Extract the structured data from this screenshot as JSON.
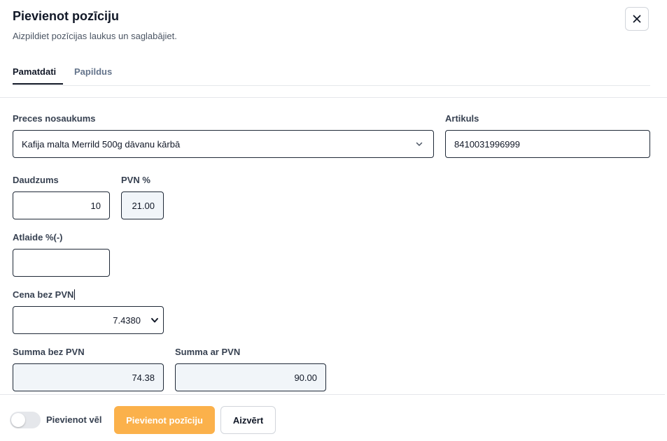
{
  "dialog": {
    "title": "Pievienot pozīciju",
    "subtitle": "Aizpildiet pozīcijas laukus un saglabājiet."
  },
  "tabs": [
    {
      "label": "Pamatdati",
      "active": true
    },
    {
      "label": "Papildus",
      "active": false
    }
  ],
  "form": {
    "product_name": {
      "label": "Preces nosaukums",
      "value": "Kafija malta Merrild 500g dāvanu kārbā"
    },
    "article": {
      "label": "Artikuls",
      "value": "8410031996999"
    },
    "quantity": {
      "label": "Daudzums",
      "value": "10"
    },
    "vat_percent": {
      "label": "PVN %",
      "value": "21.00"
    },
    "discount": {
      "label": "Atlaide %(-)",
      "value": ""
    },
    "price_excl_vat": {
      "label": "Cena bez PVN",
      "value": "7.4380"
    },
    "sum_excl_vat": {
      "label": "Summa bez PVN",
      "value": "74.38"
    },
    "sum_incl_vat": {
      "label": "Summa ar PVN",
      "value": "90.00"
    }
  },
  "footer": {
    "toggle_label": "Pievienot vēl",
    "toggle_on": false,
    "add_button": "Pievienot pozīciju",
    "close_button": "Aizvērt"
  },
  "icons": {
    "close": "close-icon",
    "dropdown": "chevron-down-icon"
  },
  "colors": {
    "primary": "#fbb14b",
    "readonly_bg": "#f1f5f9",
    "border": "#1f2937"
  }
}
